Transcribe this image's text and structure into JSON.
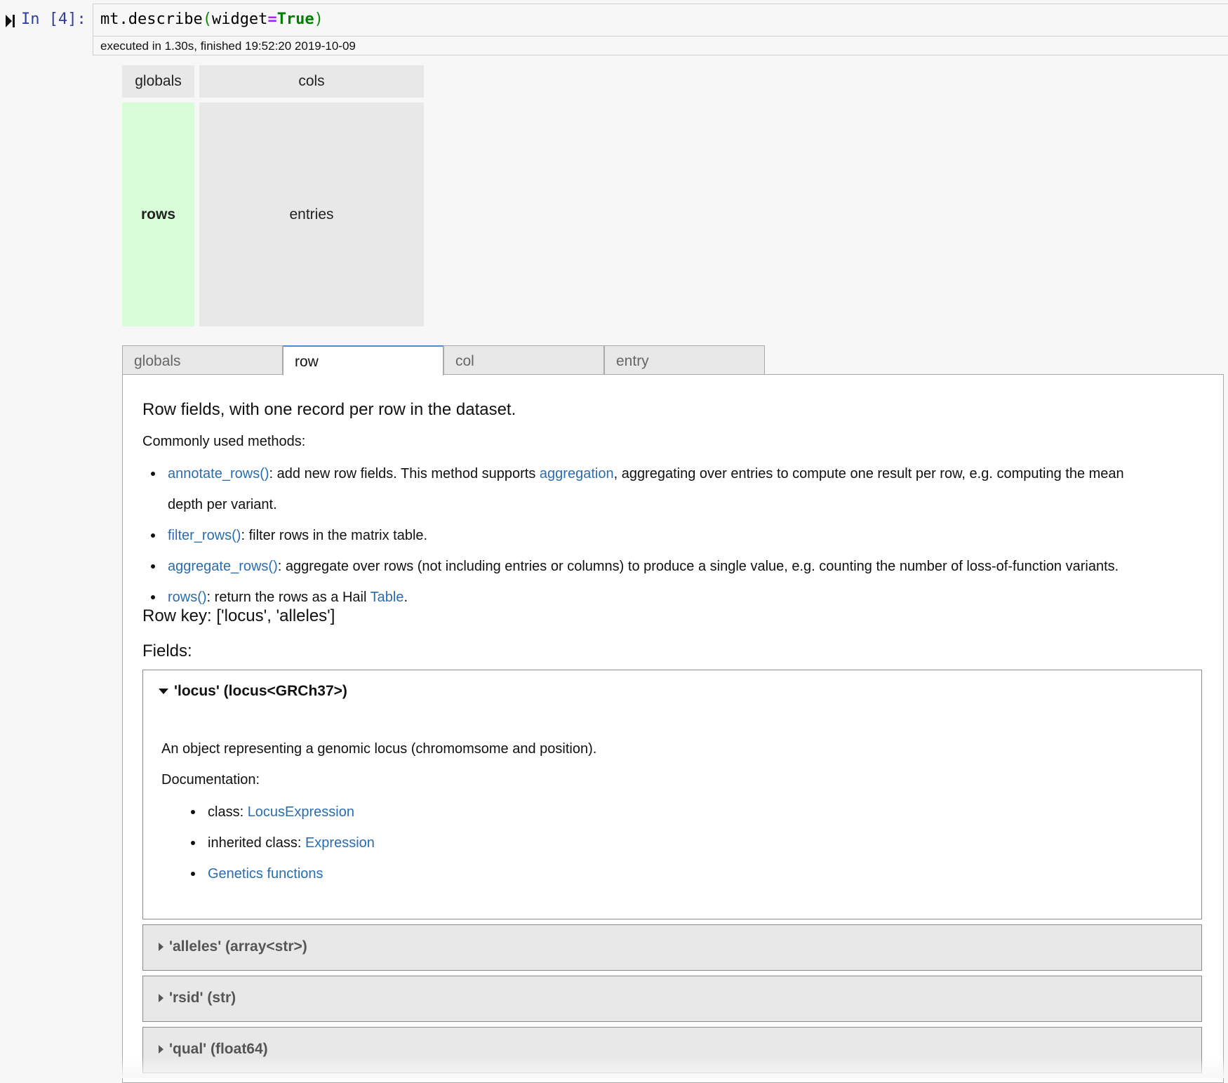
{
  "cell": {
    "prompt": "In [4]:",
    "code": {
      "obj": "mt.describe",
      "open_paren": "(",
      "arg": "widget",
      "op": "=",
      "value": "True",
      "close_paren": ")"
    },
    "exec_info": "executed in 1.30s, finished 19:52:20 2019-10-09"
  },
  "grid": {
    "globals": "globals",
    "cols": "cols",
    "rows": "rows",
    "entries": "entries",
    "active": "rows",
    "active_color": "#d7fcd7",
    "inactive_color": "#e8e8e8"
  },
  "tabs": [
    {
      "label": "globals",
      "active": false
    },
    {
      "label": "row",
      "active": true
    },
    {
      "label": "col",
      "active": false
    },
    {
      "label": "entry",
      "active": false
    }
  ],
  "panel": {
    "heading": "Row fields, with one record per row in the dataset.",
    "methods_intro": "Commonly used methods:",
    "methods": [
      {
        "link": "annotate_rows()",
        "text_a": ": add new row fields. This method supports ",
        "link2": "aggregation",
        "text_b": ", aggregating over entries to compute one result per row, e.g. computing the mean",
        "text_c": "depth per variant."
      },
      {
        "link": "filter_rows()",
        "text_a": ": filter rows in the matrix table."
      },
      {
        "link": "aggregate_rows()",
        "text_a": ": aggregate over rows (not including entries or columns) to produce a single value, e.g. counting the number of loss-of-function variants."
      },
      {
        "link": "rows()",
        "text_a": ": return the rows as a Hail ",
        "link2": "Table",
        "text_b": "."
      }
    ],
    "row_key": "Row key: ['locus', 'alleles']",
    "fields_label": "Fields:"
  },
  "fields": {
    "locus": {
      "title": "'locus' (locus<GRCh37>)",
      "description": "An object representing a genomic locus (chromomsome and position).",
      "doc_label": "Documentation:",
      "docs": [
        {
          "prefix": "class: ",
          "link": "LocusExpression"
        },
        {
          "prefix": "inherited class: ",
          "link": "Expression"
        },
        {
          "prefix": "",
          "link": "Genetics functions"
        }
      ]
    },
    "alleles": {
      "title": "'alleles' (array<str>)"
    },
    "rsid": {
      "title": "'rsid' (str)"
    },
    "qual": {
      "title": "'qual' (float64)"
    }
  },
  "colors": {
    "link": "#2a6cb0",
    "prompt": "#303f9f",
    "tab_accent": "#4a8ad6"
  },
  "icons": {
    "run": "run-cell-icon",
    "expanded": "caret-down-icon",
    "collapsed": "caret-right-icon"
  }
}
